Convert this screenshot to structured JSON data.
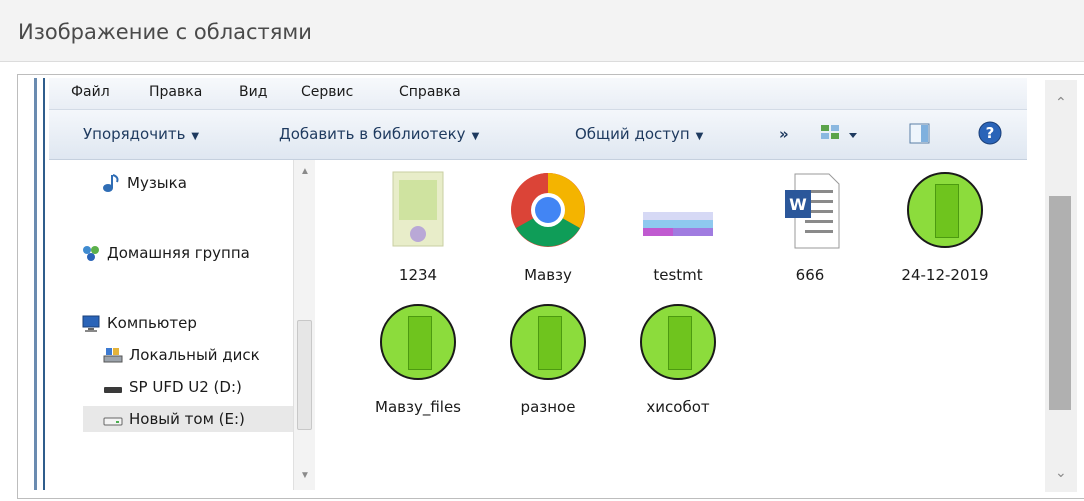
{
  "dialog": {
    "title": "Изображение с областями"
  },
  "menu": [
    "Файл",
    "Правка",
    "Вид",
    "Сервис",
    "Справка"
  ],
  "toolbar": {
    "organize": "Упорядочить",
    "add_library": "Добавить в библиотеку",
    "share": "Общий доступ",
    "more": "»"
  },
  "nav": {
    "music": "Музыка",
    "homegroup": "Домашняя группа",
    "computer": "Компьютер",
    "local_disk": "Локальный диск",
    "sp_drive": "SP UFD U2 (D:)",
    "new_volume": "Новый том (E:)"
  },
  "files": [
    {
      "name": "1234",
      "icon": "image-file-icon"
    },
    {
      "name": "Мавзу",
      "icon": "chrome-icon"
    },
    {
      "name": "testmt",
      "icon": "image-file-icon"
    },
    {
      "name": "666",
      "icon": "word-doc-icon"
    },
    {
      "name": "24-12-2019",
      "icon": "green-folder-icon"
    },
    {
      "name": "Мавзу_files",
      "icon": "green-folder-icon"
    },
    {
      "name": "разное",
      "icon": "green-folder-icon"
    },
    {
      "name": "хисобот",
      "icon": "green-folder-icon"
    }
  ],
  "colors": {
    "highlight_green": "#8cdc3c",
    "toolbar_text": "#1e3a5f",
    "word_blue": "#2b579a"
  }
}
